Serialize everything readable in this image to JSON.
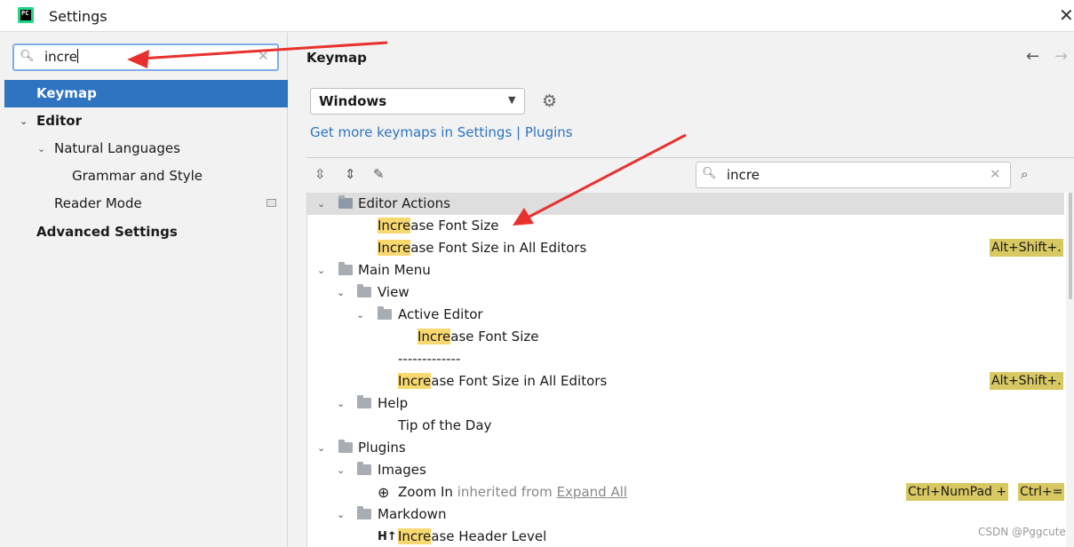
{
  "window": {
    "title": "Settings",
    "app_icon": "pycharm-icon",
    "close_icon": "close-icon"
  },
  "sidebar": {
    "search_value": "incre",
    "items": [
      {
        "label": "Keymap"
      },
      {
        "label": "Editor"
      },
      {
        "label": "Natural Languages"
      },
      {
        "label": "Grammar and Style"
      },
      {
        "label": "Reader Mode"
      },
      {
        "label": "Advanced Settings"
      }
    ]
  },
  "main": {
    "title": "Keymap",
    "keymap_value": "Windows",
    "plugins_link": "Get more keymaps in Settings | Plugins",
    "filter_value": "incre"
  },
  "tree": {
    "editor_actions": "Editor Actions",
    "main_menu": "Main Menu",
    "view": "View",
    "active_editor": "Active Editor",
    "separator": "-------------",
    "help": "Help",
    "tip_of_day": "Tip of the Day",
    "plugins": "Plugins",
    "images": "Images",
    "zoom_in": "Zoom In",
    "inherited_from": "inherited from",
    "expand_all": "Expand All",
    "markdown": "Markdown",
    "highlight": "Incre",
    "increase_font_rest": "ase Font Size",
    "increase_all_rest": "ase Font Size in All Editors",
    "increase_header_rest": "ase Header Level",
    "shortcut_alt_shift": "Alt+Shift+.",
    "shortcut_ctrl_numpad": "Ctrl+NumPad +",
    "shortcut_ctrl_eq": "Ctrl+=",
    "header_icon": "H↑"
  },
  "colors": {
    "selection": "#2f74c0",
    "highlight": "#f9d870",
    "shortcut_bg": "#d8c862",
    "annotation_arrow": "#e8312f"
  },
  "watermark": "CSDN @Pggcute"
}
